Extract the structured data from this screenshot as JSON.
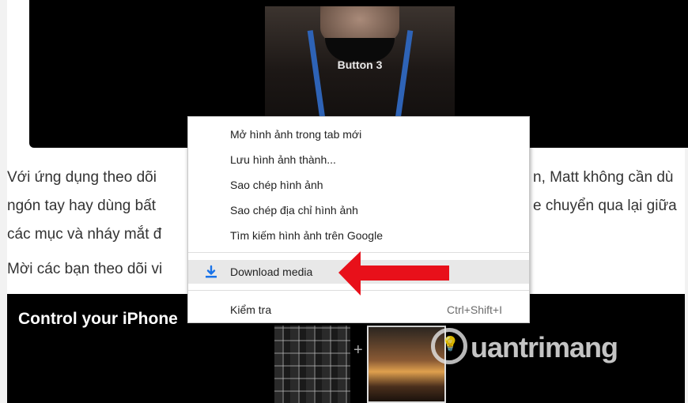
{
  "video_top": {
    "caption": "Button 3"
  },
  "article": {
    "line1_left": "Với ứng dụng theo dõi",
    "line1_right": "n, Matt không cần dù",
    "line2_left": "ngón tay hay dùng bất",
    "line2_right": "e chuyển qua lại giữa",
    "line3_left": "các mục và nháy mắt đ",
    "line4_left": "Mời các bạn theo dõi vi"
  },
  "video_bottom": {
    "title": "Control your iPhone"
  },
  "watermark": {
    "text": "uantrimang"
  },
  "context_menu": {
    "items": [
      {
        "label": "Mở hình ảnh trong tab mới"
      },
      {
        "label": "Lưu hình ảnh thành..."
      },
      {
        "label": "Sao chép hình ảnh"
      },
      {
        "label": "Sao chép địa chỉ hình ảnh"
      },
      {
        "label": "Tìm kiếm hình ảnh trên Google"
      }
    ],
    "download": {
      "label": "Download media",
      "icon": "download-icon"
    },
    "inspect": {
      "label": "Kiểm tra",
      "shortcut": "Ctrl+Shift+I"
    }
  },
  "colors": {
    "accent_arrow": "#e8101a",
    "download_icon": "#1a73e8"
  }
}
